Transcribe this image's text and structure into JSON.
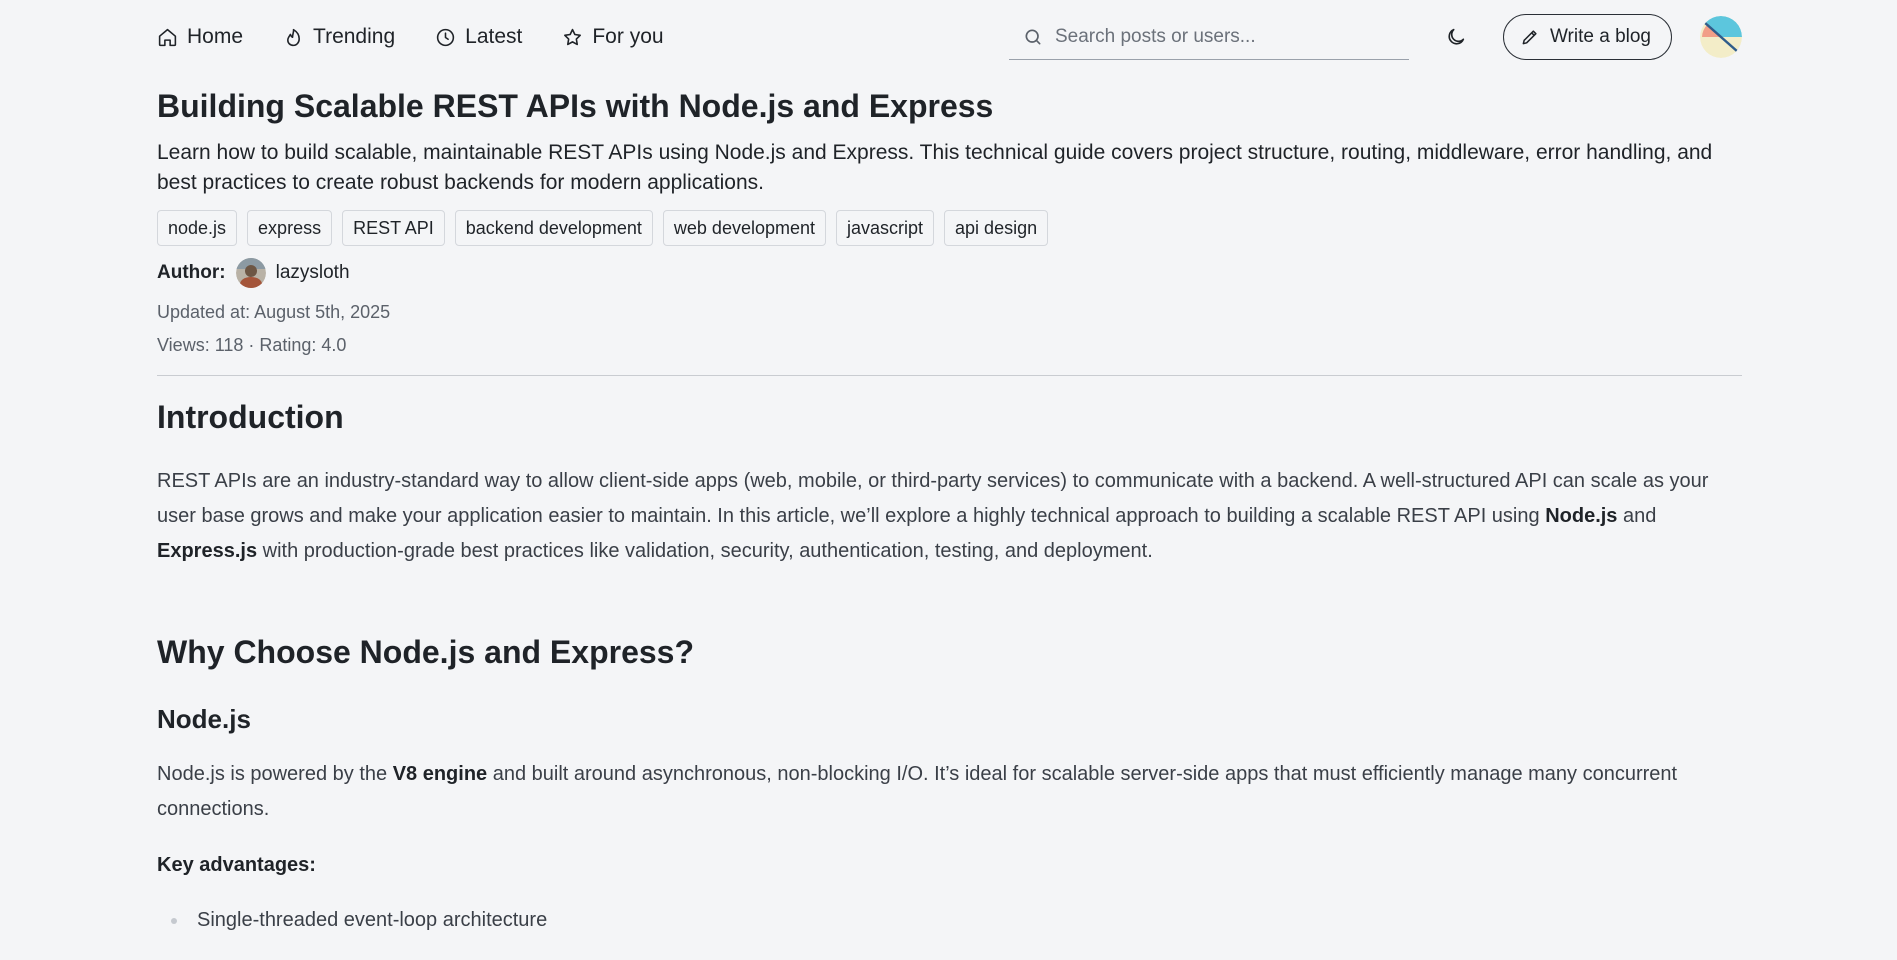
{
  "nav": {
    "links": [
      {
        "label": "Home",
        "icon": "home-icon"
      },
      {
        "label": "Trending",
        "icon": "flame-icon"
      },
      {
        "label": "Latest",
        "icon": "clock-icon"
      },
      {
        "label": "For you",
        "icon": "star-icon"
      }
    ],
    "search_placeholder": "Search posts or users...",
    "write_label": "Write a blog"
  },
  "article": {
    "title": "Building Scalable REST APIs with Node.js and Express",
    "summary": "Learn how to build scalable, maintainable REST APIs using Node.js and Express. This technical guide covers project structure, routing, middleware, error handling, and best practices to create robust backends for modern applications.",
    "tags": [
      "node.js",
      "express",
      "REST API",
      "backend development",
      "web development",
      "javascript",
      "api design"
    ],
    "author_label": "Author:",
    "author_name": "lazysloth",
    "updated": "Updated at: August 5th, 2025",
    "stats": "Views: 118 · Rating: 4.0"
  },
  "body": {
    "intro_heading": "Introduction",
    "intro_para": {
      "p1": "REST APIs are an industry-standard way to allow client-side apps (web, mobile, or third-party services) to communicate with a backend. A well-structured API can scale as your user base grows and make your application easier to maintain. In this article, we’ll explore a highly technical approach to building a scalable REST API using ",
      "b1": "Node.js",
      "p2": " and ",
      "b2": "Express.js",
      "p3": " with production-grade best practices like validation, security, authentication, testing, and deployment."
    },
    "why_heading": "Why Choose Node.js and Express?",
    "node_heading": "Node.js",
    "node_para": {
      "p1": "Node.js is powered by the ",
      "b1": "V8 engine",
      "p2": " and built around asynchronous, non-blocking I/O. It’s ideal for scalable server-side apps that must efficiently manage many concurrent connections."
    },
    "key_label": "Key advantages:",
    "advantages": [
      "Single-threaded event-loop architecture"
    ]
  },
  "colors": {
    "background": "#f4f5f7",
    "text": "#1f2328",
    "muted": "#5b616a"
  }
}
